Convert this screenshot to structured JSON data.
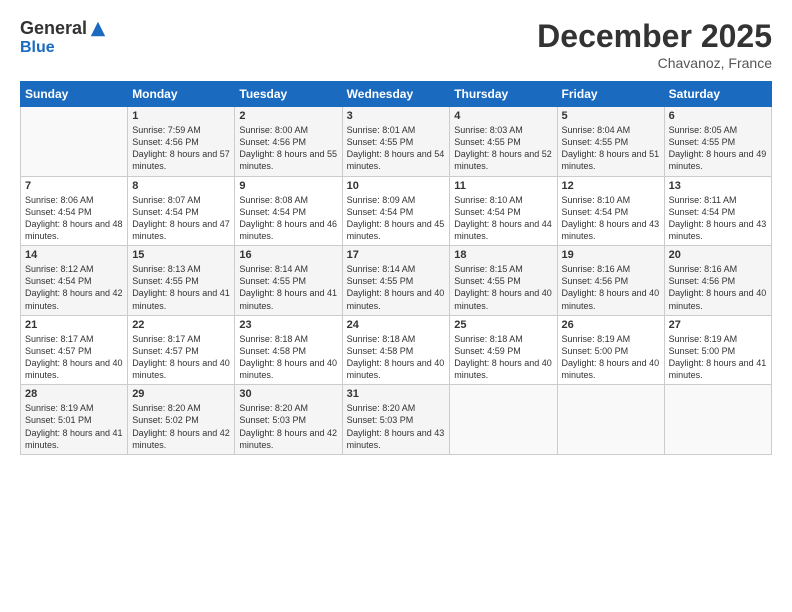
{
  "logo": {
    "general": "General",
    "blue": "Blue"
  },
  "header": {
    "month": "December 2025",
    "location": "Chavanoz, France"
  },
  "days_of_week": [
    "Sunday",
    "Monday",
    "Tuesday",
    "Wednesday",
    "Thursday",
    "Friday",
    "Saturday"
  ],
  "weeks": [
    [
      {
        "num": "",
        "sunrise": "",
        "sunset": "",
        "daylight": ""
      },
      {
        "num": "1",
        "sunrise": "Sunrise: 7:59 AM",
        "sunset": "Sunset: 4:56 PM",
        "daylight": "Daylight: 8 hours and 57 minutes."
      },
      {
        "num": "2",
        "sunrise": "Sunrise: 8:00 AM",
        "sunset": "Sunset: 4:56 PM",
        "daylight": "Daylight: 8 hours and 55 minutes."
      },
      {
        "num": "3",
        "sunrise": "Sunrise: 8:01 AM",
        "sunset": "Sunset: 4:55 PM",
        "daylight": "Daylight: 8 hours and 54 minutes."
      },
      {
        "num": "4",
        "sunrise": "Sunrise: 8:03 AM",
        "sunset": "Sunset: 4:55 PM",
        "daylight": "Daylight: 8 hours and 52 minutes."
      },
      {
        "num": "5",
        "sunrise": "Sunrise: 8:04 AM",
        "sunset": "Sunset: 4:55 PM",
        "daylight": "Daylight: 8 hours and 51 minutes."
      },
      {
        "num": "6",
        "sunrise": "Sunrise: 8:05 AM",
        "sunset": "Sunset: 4:55 PM",
        "daylight": "Daylight: 8 hours and 49 minutes."
      }
    ],
    [
      {
        "num": "7",
        "sunrise": "Sunrise: 8:06 AM",
        "sunset": "Sunset: 4:54 PM",
        "daylight": "Daylight: 8 hours and 48 minutes."
      },
      {
        "num": "8",
        "sunrise": "Sunrise: 8:07 AM",
        "sunset": "Sunset: 4:54 PM",
        "daylight": "Daylight: 8 hours and 47 minutes."
      },
      {
        "num": "9",
        "sunrise": "Sunrise: 8:08 AM",
        "sunset": "Sunset: 4:54 PM",
        "daylight": "Daylight: 8 hours and 46 minutes."
      },
      {
        "num": "10",
        "sunrise": "Sunrise: 8:09 AM",
        "sunset": "Sunset: 4:54 PM",
        "daylight": "Daylight: 8 hours and 45 minutes."
      },
      {
        "num": "11",
        "sunrise": "Sunrise: 8:10 AM",
        "sunset": "Sunset: 4:54 PM",
        "daylight": "Daylight: 8 hours and 44 minutes."
      },
      {
        "num": "12",
        "sunrise": "Sunrise: 8:10 AM",
        "sunset": "Sunset: 4:54 PM",
        "daylight": "Daylight: 8 hours and 43 minutes."
      },
      {
        "num": "13",
        "sunrise": "Sunrise: 8:11 AM",
        "sunset": "Sunset: 4:54 PM",
        "daylight": "Daylight: 8 hours and 43 minutes."
      }
    ],
    [
      {
        "num": "14",
        "sunrise": "Sunrise: 8:12 AM",
        "sunset": "Sunset: 4:54 PM",
        "daylight": "Daylight: 8 hours and 42 minutes."
      },
      {
        "num": "15",
        "sunrise": "Sunrise: 8:13 AM",
        "sunset": "Sunset: 4:55 PM",
        "daylight": "Daylight: 8 hours and 41 minutes."
      },
      {
        "num": "16",
        "sunrise": "Sunrise: 8:14 AM",
        "sunset": "Sunset: 4:55 PM",
        "daylight": "Daylight: 8 hours and 41 minutes."
      },
      {
        "num": "17",
        "sunrise": "Sunrise: 8:14 AM",
        "sunset": "Sunset: 4:55 PM",
        "daylight": "Daylight: 8 hours and 40 minutes."
      },
      {
        "num": "18",
        "sunrise": "Sunrise: 8:15 AM",
        "sunset": "Sunset: 4:55 PM",
        "daylight": "Daylight: 8 hours and 40 minutes."
      },
      {
        "num": "19",
        "sunrise": "Sunrise: 8:16 AM",
        "sunset": "Sunset: 4:56 PM",
        "daylight": "Daylight: 8 hours and 40 minutes."
      },
      {
        "num": "20",
        "sunrise": "Sunrise: 8:16 AM",
        "sunset": "Sunset: 4:56 PM",
        "daylight": "Daylight: 8 hours and 40 minutes."
      }
    ],
    [
      {
        "num": "21",
        "sunrise": "Sunrise: 8:17 AM",
        "sunset": "Sunset: 4:57 PM",
        "daylight": "Daylight: 8 hours and 40 minutes."
      },
      {
        "num": "22",
        "sunrise": "Sunrise: 8:17 AM",
        "sunset": "Sunset: 4:57 PM",
        "daylight": "Daylight: 8 hours and 40 minutes."
      },
      {
        "num": "23",
        "sunrise": "Sunrise: 8:18 AM",
        "sunset": "Sunset: 4:58 PM",
        "daylight": "Daylight: 8 hours and 40 minutes."
      },
      {
        "num": "24",
        "sunrise": "Sunrise: 8:18 AM",
        "sunset": "Sunset: 4:58 PM",
        "daylight": "Daylight: 8 hours and 40 minutes."
      },
      {
        "num": "25",
        "sunrise": "Sunrise: 8:18 AM",
        "sunset": "Sunset: 4:59 PM",
        "daylight": "Daylight: 8 hours and 40 minutes."
      },
      {
        "num": "26",
        "sunrise": "Sunrise: 8:19 AM",
        "sunset": "Sunset: 5:00 PM",
        "daylight": "Daylight: 8 hours and 40 minutes."
      },
      {
        "num": "27",
        "sunrise": "Sunrise: 8:19 AM",
        "sunset": "Sunset: 5:00 PM",
        "daylight": "Daylight: 8 hours and 41 minutes."
      }
    ],
    [
      {
        "num": "28",
        "sunrise": "Sunrise: 8:19 AM",
        "sunset": "Sunset: 5:01 PM",
        "daylight": "Daylight: 8 hours and 41 minutes."
      },
      {
        "num": "29",
        "sunrise": "Sunrise: 8:20 AM",
        "sunset": "Sunset: 5:02 PM",
        "daylight": "Daylight: 8 hours and 42 minutes."
      },
      {
        "num": "30",
        "sunrise": "Sunrise: 8:20 AM",
        "sunset": "Sunset: 5:03 PM",
        "daylight": "Daylight: 8 hours and 42 minutes."
      },
      {
        "num": "31",
        "sunrise": "Sunrise: 8:20 AM",
        "sunset": "Sunset: 5:03 PM",
        "daylight": "Daylight: 8 hours and 43 minutes."
      },
      {
        "num": "",
        "sunrise": "",
        "sunset": "",
        "daylight": ""
      },
      {
        "num": "",
        "sunrise": "",
        "sunset": "",
        "daylight": ""
      },
      {
        "num": "",
        "sunrise": "",
        "sunset": "",
        "daylight": ""
      }
    ]
  ]
}
